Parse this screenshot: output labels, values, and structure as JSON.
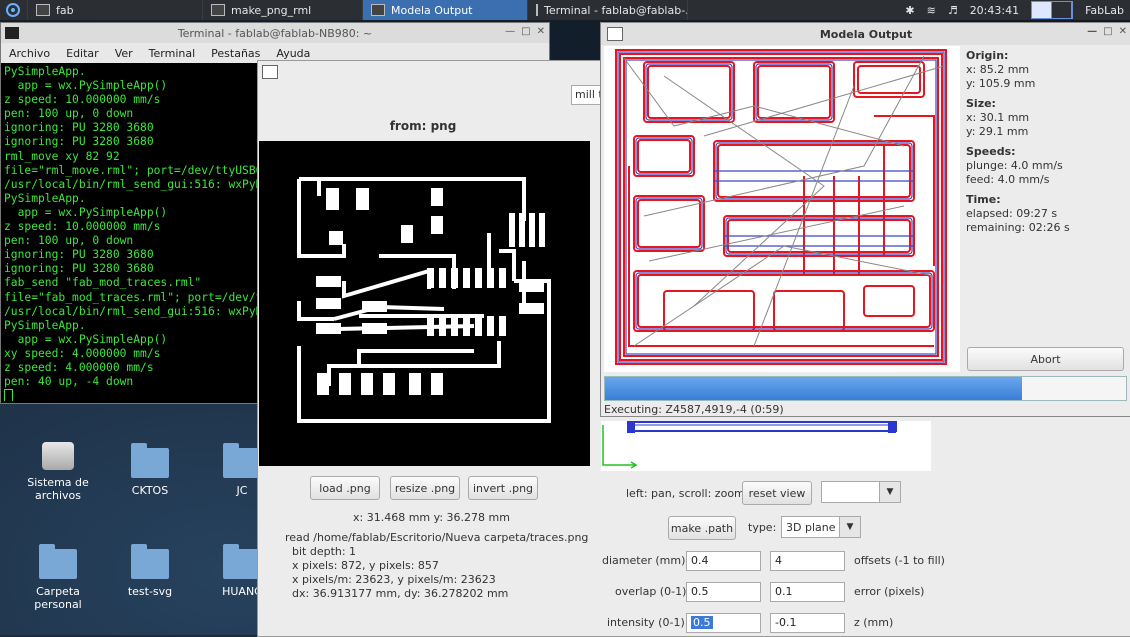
{
  "panel": {
    "tasks": [
      {
        "label": "fab",
        "active": false
      },
      {
        "label": "make_png_rml",
        "active": false
      },
      {
        "label": "Modela Output",
        "active": true
      },
      {
        "label": "Terminal - fablab@fablab-...",
        "active": false
      }
    ],
    "clock": "20:43:41",
    "user": "FabLab"
  },
  "desktop_icons": [
    {
      "label": "Sistema de archivos",
      "kind": "drive"
    },
    {
      "label": "CKTOS",
      "kind": "folder"
    },
    {
      "label": "JC",
      "kind": "folder"
    },
    {
      "label": "Carpeta personal",
      "kind": "home"
    },
    {
      "label": "test-svg",
      "kind": "folder"
    },
    {
      "label": "HUANC",
      "kind": "folder"
    }
  ],
  "terminal": {
    "title": "Terminal - fablab@fablab-NB980: ~",
    "menu": [
      "Archivo",
      "Editar",
      "Ver",
      "Terminal",
      "Pestañas",
      "Ayuda"
    ],
    "lines": [
      "PySimpleApp.",
      "  app = wx.PySimpleApp()",
      "z speed: 10.000000 mm/s",
      "pen: 100 up, 0 down",
      "ignoring: PU 3280 3680",
      "ignoring: PU 3280 3680",
      "rml_move xy 82 92",
      "file=\"rml_move.rml\"; port=/dev/ttyUSB0",
      "/usr/local/bin/rml_send_gui:516: wxPyD",
      "PySimpleApp.",
      "  app = wx.PySimpleApp()",
      "z speed: 10.000000 mm/s",
      "pen: 100 up, 0 down",
      "ignoring: PU 3280 3680",
      "ignoring: PU 3280 3680",
      "fab_send \"fab_mod_traces.rml\"",
      "file=\"fab_mod_traces.rml\"; port=/dev/t",
      "/usr/local/bin/rml_send_gui:516: wxPyD",
      "PySimpleApp.",
      "  app = wx.PySimpleApp()",
      "xy speed: 4.000000 mm/s",
      "z speed: 4.000000 mm/s",
      "pen: 40 up, -4 down"
    ]
  },
  "fab": {
    "mill_field": "mill t",
    "from_label": "from: png",
    "buttons": {
      "load": "load .png",
      "resize": "resize .png",
      "invert": "invert .png"
    },
    "coords": "x: 31.468 mm  y: 36.278 mm",
    "info_lines": [
      "read /home/fablab/Escritorio/Nueva carpeta/traces.png",
      "  bit depth: 1",
      "  x pixels: 872, y pixels: 857",
      "  x pixels/m: 23623, y pixels/m: 23623",
      "  dx: 36.913177 mm, dy: 36.278202 mm"
    ],
    "pan_hint": "left: pan, scroll: zoom",
    "reset_view": "reset view",
    "make_path": "make .path",
    "type_label": "type:",
    "type_value": "3D plane",
    "diameter_label": "diameter (mm)",
    "diameter_value": "0.4",
    "offsets_value": "4",
    "offsets_label": "offsets (-1 to fill)",
    "overlap_label": "overlap (0-1)",
    "overlap_value": "0.5",
    "error_value": "0.1",
    "error_label": "error (pixels)",
    "intensity_label": "intensity (0-1)",
    "intensity_value": "0.5",
    "z_value": "-0.1",
    "z_label": "z (mm)"
  },
  "modela": {
    "title": "Modela Output",
    "origin_heading": "Origin:",
    "origin_x": "x: 85.2 mm",
    "origin_y": "y: 105.9 mm",
    "size_heading": "Size:",
    "size_x": "x: 30.1 mm",
    "size_y": "y: 29.1 mm",
    "speeds_heading": "Speeds:",
    "plunge": "plunge: 4.0 mm/s",
    "feed": "feed: 4.0 mm/s",
    "time_heading": "Time:",
    "elapsed": "elapsed: 09:27 s",
    "remaining": "remaining: 02:26 s",
    "abort": "Abort",
    "progress": 0.8,
    "executing": "Executing: Z4587,4919,-4 (0:59)"
  },
  "colors": {
    "trace_red": "#e8141e",
    "trace_blue": "#3c46c8",
    "progress": "#3a7ed6",
    "terminal_text": "#3ce63c"
  }
}
